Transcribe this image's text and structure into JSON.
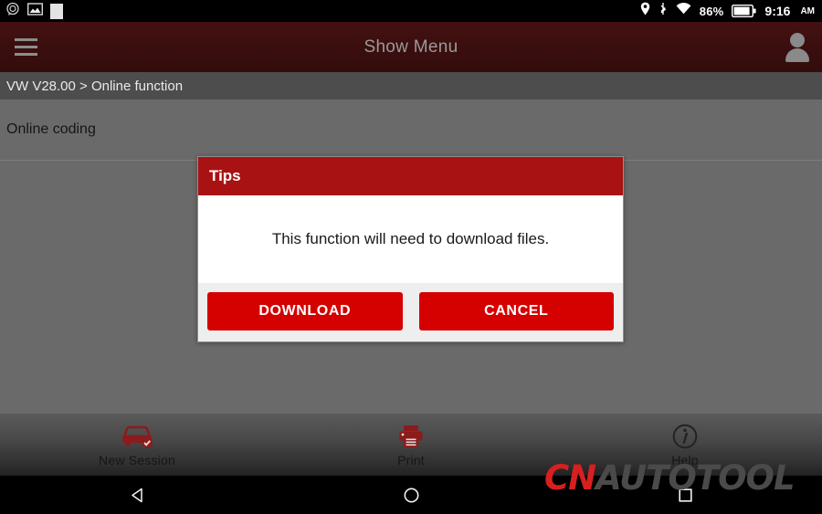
{
  "status_bar": {
    "notifications": [
      {
        "icon": "chat-bubble-icon"
      },
      {
        "icon": "image-icon"
      },
      {
        "icon": "blank-square-icon"
      }
    ],
    "location_icon": "location-pin-icon",
    "bluetooth_icon": "bluetooth-icon",
    "wifi_icon": "wifi-icon",
    "battery_percent": "86%",
    "battery_icon": "battery-icon",
    "time": "9:16",
    "meridiem": "AM"
  },
  "header": {
    "menu_icon": "hamburger-menu-icon",
    "title": "Show Menu",
    "avatar_icon": "user-avatar-icon"
  },
  "breadcrumb": {
    "text": "VW V28.00 > Online function"
  },
  "list": {
    "items": [
      {
        "label": "Online coding"
      }
    ]
  },
  "toolbar": {
    "items": [
      {
        "label": "New Session",
        "icon": "car-check-icon"
      },
      {
        "label": "Print",
        "icon": "printer-icon"
      },
      {
        "label": "Help",
        "icon": "info-circle-icon"
      }
    ]
  },
  "nav_bar": {
    "back": "back-triangle-icon",
    "home": "home-circle-icon",
    "recents": "recents-square-icon"
  },
  "watermark": {
    "part1": "CN",
    "part2": "AUTOTOOL"
  },
  "dialog": {
    "title": "Tips",
    "message": "This function will need to download files.",
    "buttons": [
      {
        "label": "DOWNLOAD"
      },
      {
        "label": "CANCEL"
      }
    ]
  },
  "colors": {
    "header_red": "#3b0e0e",
    "dialog_red": "#a81212",
    "button_red": "#d50000",
    "accent_red": "#d81f1f",
    "background_gray": "#6a6a6a",
    "breadcrumb_gray": "#4d4d4d"
  }
}
